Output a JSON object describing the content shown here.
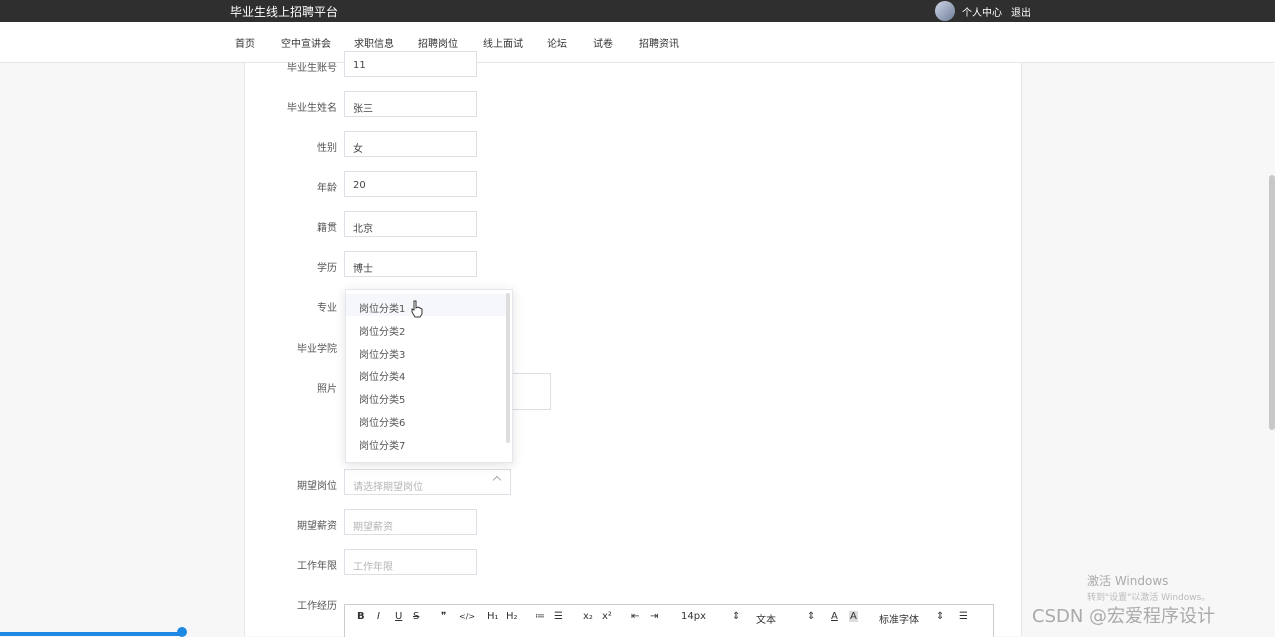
{
  "header": {
    "site_title": "毕业生线上招聘平台",
    "personal_center": "个人中心",
    "logout": "退出"
  },
  "nav": {
    "items": [
      "首页",
      "空中宣讲会",
      "求职信息",
      "招聘岗位",
      "线上面试",
      "论坛",
      "试卷",
      "招聘资讯"
    ]
  },
  "form": {
    "account_label": "毕业生账号",
    "account_value": "11",
    "name_label": "毕业生姓名",
    "name_value": "张三",
    "gender_label": "性别",
    "gender_value": "女",
    "age_label": "年龄",
    "age_value": "20",
    "origin_label": "籍贯",
    "origin_value": "北京",
    "education_label": "学历",
    "education_value": "博士",
    "major_label": "专业",
    "school_label": "毕业学院",
    "photo_label": "照片",
    "expected_position_label": "期望岗位",
    "expected_position_placeholder": "请选择期望岗位",
    "expected_salary_label": "期望薪资",
    "expected_salary_placeholder": "期望薪资",
    "work_years_label": "工作年限",
    "work_years_placeholder": "工作年限",
    "work_experience_label": "工作经历"
  },
  "dropdown": {
    "options": [
      "岗位分类1",
      "岗位分类2",
      "岗位分类3",
      "岗位分类4",
      "岗位分类5",
      "岗位分类6",
      "岗位分类7"
    ],
    "hovered_index": 0
  },
  "editor_toolbar": {
    "bold": "B",
    "italic": "I",
    "underline": "U",
    "strike": "S",
    "quote": "❞",
    "code": "</>",
    "h1": "H₁",
    "h2": "H₂",
    "ordered_list": "≔",
    "bullet_list": "☰",
    "subscript": "x₂",
    "superscript": "x²",
    "outdent": "⇤",
    "indent": "⇥",
    "font_size": "14px",
    "paragraph": "文本",
    "font_color": "A",
    "bg_color": "A",
    "font_family": "标准字体",
    "align": "☰"
  },
  "watermark": {
    "activate_title": "激活 Windows",
    "activate_hint": "转到\"设置\"以激活 Windows。",
    "csdn": "CSDN @宏爱程序设计"
  }
}
